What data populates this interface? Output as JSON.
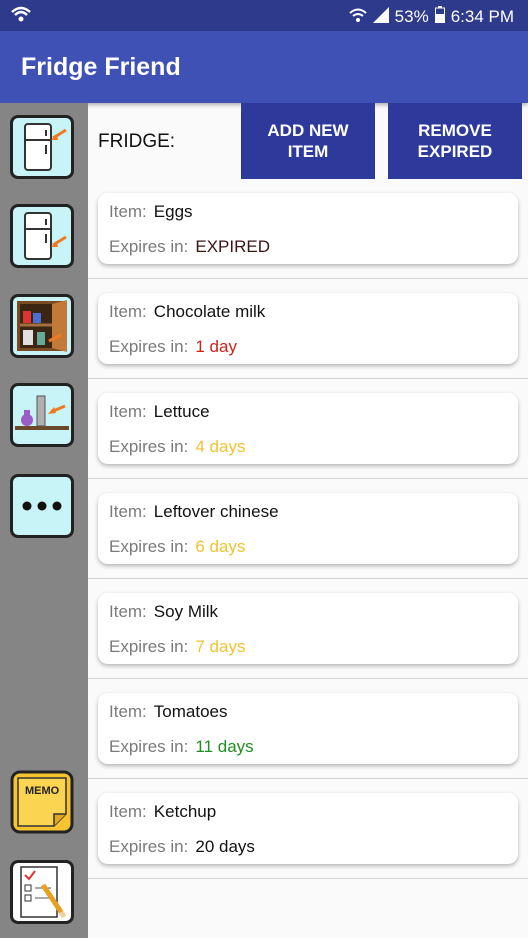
{
  "status_bar": {
    "battery": "53%",
    "time": "6:34 PM"
  },
  "app": {
    "title": "Fridge Friend"
  },
  "controls": {
    "section_label": "FRIDGE:",
    "add_label": "ADD NEW ITEM",
    "remove_label_line1": "REMOVE",
    "remove_label_line2": "EXPIRED"
  },
  "sidebar": {
    "items": [
      {
        "name": "fridge",
        "icon": "fridge-icon"
      },
      {
        "name": "fridge-2",
        "icon": "fridge-icon"
      },
      {
        "name": "pantry",
        "icon": "pantry-icon"
      },
      {
        "name": "shelf",
        "icon": "shelf-icon"
      },
      {
        "name": "more",
        "icon": "ellipsis-icon"
      },
      {
        "name": "memo",
        "icon": "memo-icon",
        "text": "MEMO"
      },
      {
        "name": "checklist",
        "icon": "checklist-icon"
      }
    ]
  },
  "labels": {
    "item": "Item:",
    "expires": "Expires in:"
  },
  "items": [
    {
      "name": "Eggs",
      "expires": "EXPIRED",
      "color": "#3b1512"
    },
    {
      "name": "Chocolate milk",
      "expires": "1 day",
      "color": "#d0201a"
    },
    {
      "name": "Lettuce",
      "expires": "4 days",
      "color": "#f2c232"
    },
    {
      "name": "Leftover chinese",
      "expires": "6 days",
      "color": "#f2c232"
    },
    {
      "name": "Soy Milk",
      "expires": "7 days",
      "color": "#f2c232"
    },
    {
      "name": "Tomatoes",
      "expires": "11 days",
      "color": "#1e8e1e"
    },
    {
      "name": "Ketchup",
      "expires": "20 days",
      "color": "#111111"
    }
  ]
}
